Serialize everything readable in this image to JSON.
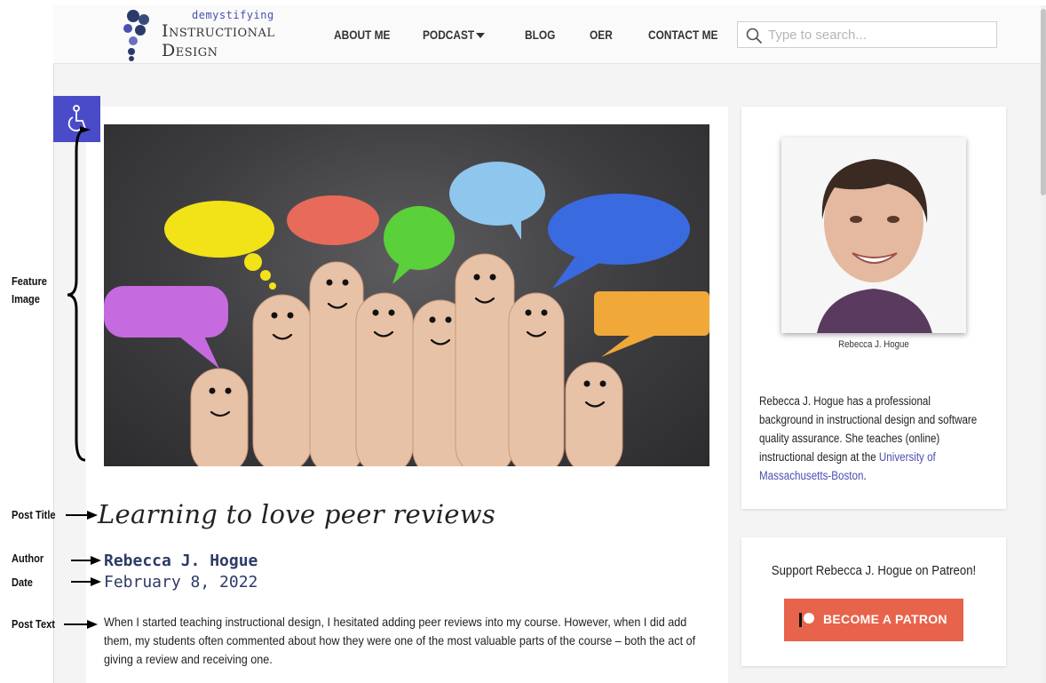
{
  "logo": {
    "small": "demystifying",
    "line1": "Instructional",
    "line2": "Design"
  },
  "nav": {
    "items": [
      "ABOUT ME",
      "PODCAST",
      "BLOG",
      "OER",
      "CONTACT ME"
    ]
  },
  "search": {
    "placeholder": "Type to search..."
  },
  "post": {
    "title": "Learning to love peer reviews",
    "author": "Rebecca J. Hogue",
    "date": "February 8, 2022",
    "text": "When I started teaching instructional design, I hesitated adding peer reviews into my course. However, when I did add them, my students often commented about how they were one of the most valuable parts of the course – both the act of giving a review and receiving one."
  },
  "annotations": {
    "feature_image_1": "Feature",
    "feature_image_2": "Image",
    "post_title": "Post Title",
    "author": "Author",
    "date": "Date",
    "post_text": "Post Text"
  },
  "sidebar": {
    "caption": "Rebecca J. Hogue",
    "bio_text": "Rebecca J. Hogue has a professional background in instructional design and software quality assurance. She teaches (online) instructional design at the ",
    "bio_link": "University of Massachusetts-Boston",
    "bio_end": ".",
    "patreon_text": "Support Rebecca J. Hogue on Patreon!",
    "patreon_button": "BECOME A PATRON"
  },
  "colors": {
    "accent": "#4a4bc8",
    "patreon": "#e8634b",
    "author_text": "#2d3a66"
  },
  "icons": [
    "search-icon",
    "accessibility-icon",
    "patreon-icon",
    "caret-down-icon"
  ]
}
